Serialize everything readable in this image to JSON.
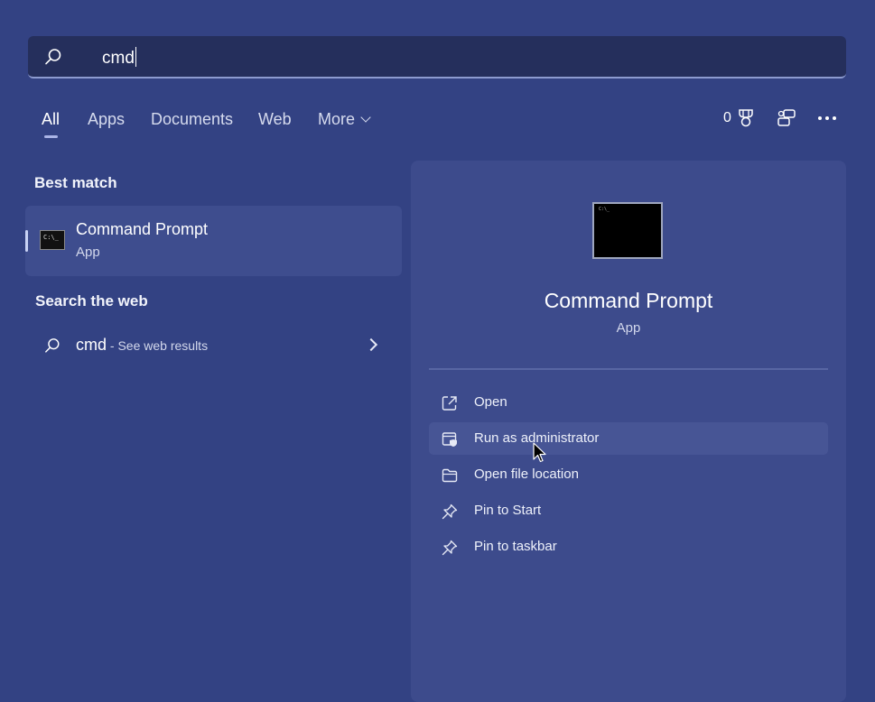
{
  "search": {
    "query": "cmd"
  },
  "tabs": [
    {
      "label": "All"
    },
    {
      "label": "Apps"
    },
    {
      "label": "Documents"
    },
    {
      "label": "Web"
    },
    {
      "label": "More"
    }
  ],
  "toolbar": {
    "points": "0",
    "icons": [
      "trophy-icon",
      "chat-icon",
      "more-options-icon"
    ]
  },
  "best_match": {
    "title": "Best match",
    "item": {
      "name": "Command Prompt",
      "type": "App"
    }
  },
  "search_web": {
    "title": "Search the web",
    "query": "cmd",
    "hint": " - See web results"
  },
  "detail": {
    "title": "Command Prompt",
    "type": "App",
    "actions": [
      {
        "label": "Open",
        "icon": "open-external-icon"
      },
      {
        "label": "Run as administrator",
        "icon": "shield-window-icon"
      },
      {
        "label": "Open file location",
        "icon": "folder-icon"
      },
      {
        "label": "Pin to Start",
        "icon": "pin-icon"
      },
      {
        "label": "Pin to taskbar",
        "icon": "pin-icon"
      }
    ]
  },
  "colors": {
    "background": "#334283",
    "panel": "#3d4b8c",
    "search": "#252f5c",
    "accent": "#aab4e6"
  }
}
